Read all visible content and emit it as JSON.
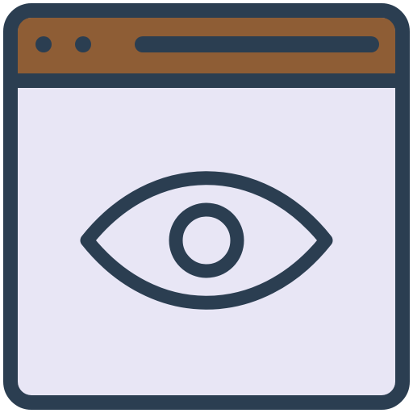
{
  "icon": {
    "name": "browser-window-eye-icon",
    "colors": {
      "outline": "#2b3e51",
      "title_bar": "#8e5d35",
      "window_body": "#e8e6f5",
      "eye_fill": "#e8e6f5"
    }
  }
}
